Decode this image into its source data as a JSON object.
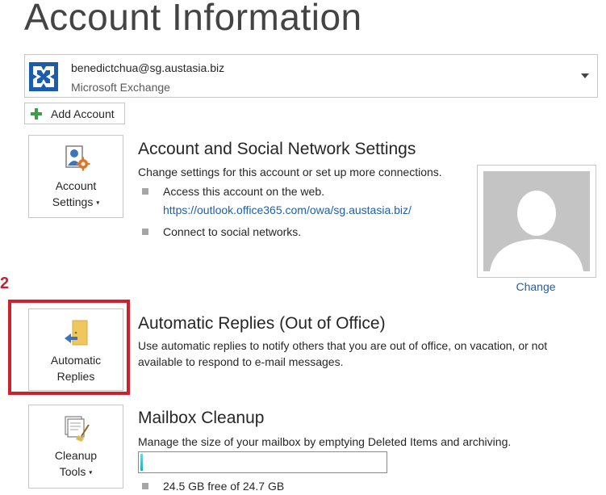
{
  "header": {
    "title": "Account Information"
  },
  "account": {
    "email": "benedictchua@sg.austasia.biz",
    "type": "Microsoft Exchange"
  },
  "add_account": {
    "label": "Add Account"
  },
  "account_settings": {
    "button_line1": "Account",
    "button_line2": "Settings",
    "title": "Account and Social Network Settings",
    "description": "Change settings for this account or set up more connections.",
    "bullet1": "Access this account on the web.",
    "web_link": "https://outlook.office365.com/owa/sg.austasia.biz/",
    "bullet2": "Connect to social networks."
  },
  "photo": {
    "change_label": "Change"
  },
  "annotation": {
    "step": "2",
    "color": "#d0202e"
  },
  "automatic_replies": {
    "button_line1": "Automatic",
    "button_line2": "Replies",
    "title": "Automatic Replies (Out of Office)",
    "description_line1": "Use automatic replies to notify others that you are out of office, on vacation, or not",
    "description_line2": "available to respond to e-mail messages."
  },
  "mailbox_cleanup": {
    "button_line1": "Cleanup",
    "button_line2": "Tools",
    "title": "Mailbox Cleanup",
    "description": "Manage the size of your mailbox by emptying Deleted Items and archiving.",
    "storage_used_fraction": 0.008,
    "storage_text": "24.5 GB free of 24.7 GB"
  },
  "icons": {
    "exchange": "exchange-icon",
    "add": "plus-icon",
    "account_settings": "account-settings-icon",
    "automatic_replies": "door-arrow-icon",
    "cleanup": "cleanup-broom-icon",
    "profile": "profile-silhouette-icon"
  },
  "colors": {
    "link": "#1e5fa8",
    "highlight": "#d0202e",
    "exchange_blue": "#1b5cad",
    "storage_fill": "#2aa7c0"
  }
}
